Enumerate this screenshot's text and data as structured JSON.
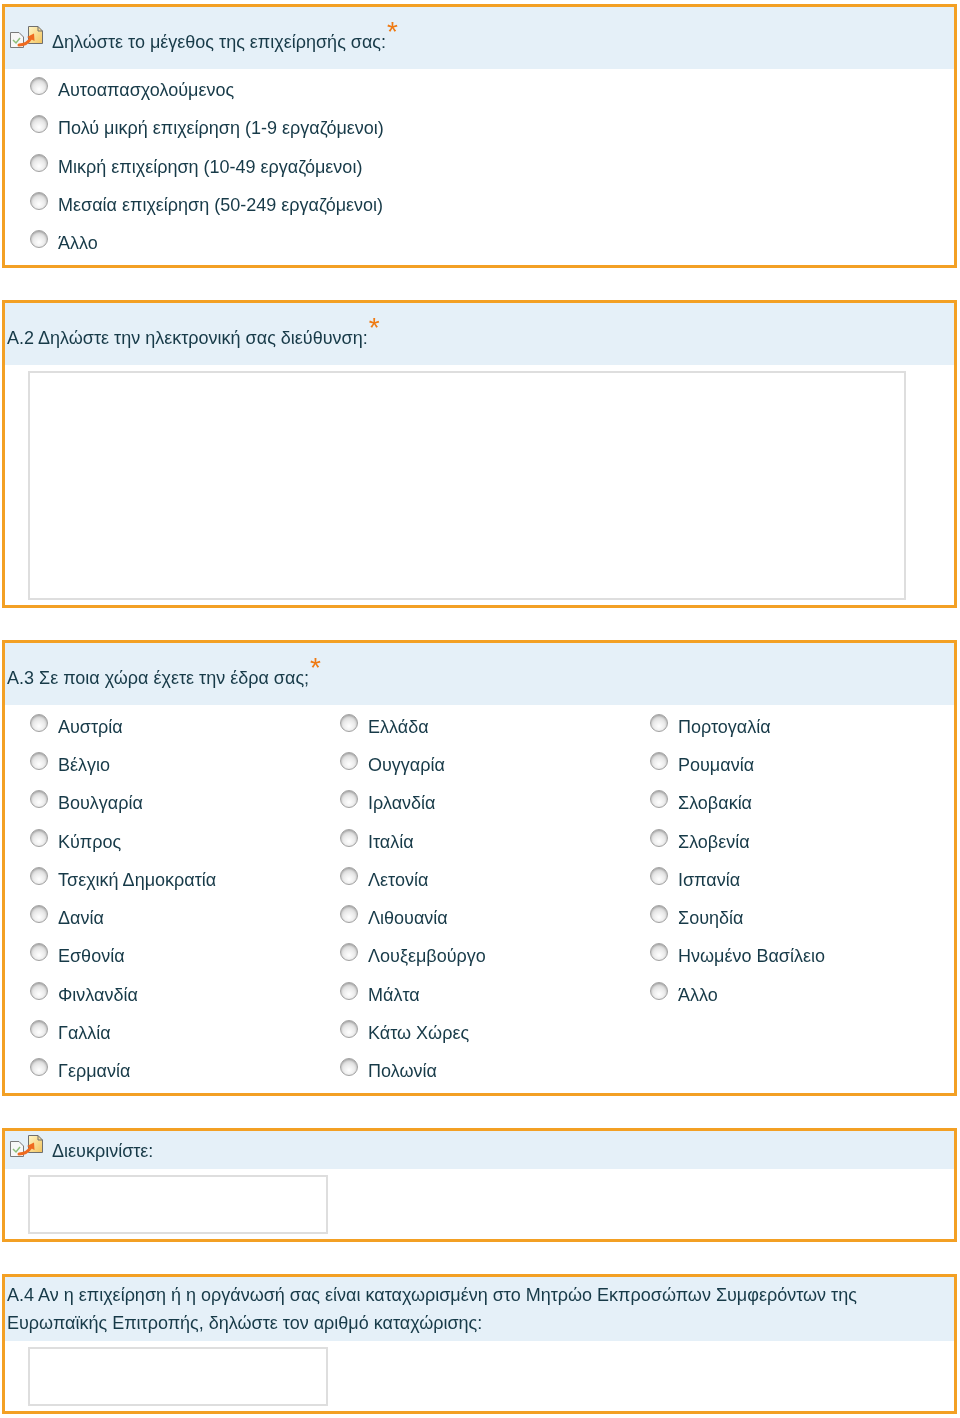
{
  "questions": [
    {
      "kind": "radio",
      "icon": true,
      "title": "Δηλώστε το μέγεθος της επιχείρησής σας:",
      "required_mark": "*",
      "option_columns": [
        [
          {
            "label": "Αυτοαπασχολούμενος",
            "selected": false
          },
          {
            "label": "Πολύ μικρή επιχείρηση (1-9 εργαζόμενοι)",
            "selected": false
          },
          {
            "label": "Μικρή επιχείρηση (10-49 εργαζόμενοι)",
            "selected": false
          },
          {
            "label": "Μεσαία επιχείρηση (50-249 εργαζόμενοι)",
            "selected": false
          },
          {
            "label": "Άλλο",
            "selected": false
          }
        ]
      ]
    },
    {
      "kind": "textarea",
      "icon": false,
      "title": "Α.2 Δηλώστε την ηλεκτρονική σας διεύθυνση:",
      "required_mark": "*"
    },
    {
      "kind": "radio",
      "icon": false,
      "title": "Α.3 Σε ποια χώρα έχετε την έδρα σας;",
      "required_mark": "*",
      "option_columns": [
        [
          {
            "label": "Αυστρία",
            "selected": false
          },
          {
            "label": "Βέλγιο",
            "selected": false
          },
          {
            "label": "Βουλγαρία",
            "selected": false
          },
          {
            "label": "Κύπρος",
            "selected": false
          },
          {
            "label": "Τσεχική Δημοκρατία",
            "selected": false
          },
          {
            "label": "Δανία",
            "selected": false
          },
          {
            "label": "Εσθονία",
            "selected": false
          },
          {
            "label": "Φινλανδία",
            "selected": false
          },
          {
            "label": "Γαλλία",
            "selected": false
          },
          {
            "label": "Γερμανία",
            "selected": false
          }
        ],
        [
          {
            "label": "Ελλάδα",
            "selected": false
          },
          {
            "label": "Ουγγαρία",
            "selected": false
          },
          {
            "label": "Ιρλανδία",
            "selected": false
          },
          {
            "label": "Ιταλία",
            "selected": false
          },
          {
            "label": "Λετονία",
            "selected": false
          },
          {
            "label": "Λιθουανία",
            "selected": false
          },
          {
            "label": "Λουξεμβούργο",
            "selected": false
          },
          {
            "label": "Μάλτα",
            "selected": false
          },
          {
            "label": "Κάτω Χώρες",
            "selected": false
          },
          {
            "label": "Πολωνία",
            "selected": false
          }
        ],
        [
          {
            "label": "Πορτογαλία",
            "selected": false
          },
          {
            "label": "Ρουμανία",
            "selected": false
          },
          {
            "label": "Σλοβακία",
            "selected": false
          },
          {
            "label": "Σλοβενία",
            "selected": false
          },
          {
            "label": "Ισπανία",
            "selected": false
          },
          {
            "label": "Σουηδία",
            "selected": false
          },
          {
            "label": "Ηνωμένο Βασίλειο",
            "selected": false
          },
          {
            "label": "Άλλο",
            "selected": false
          }
        ]
      ]
    },
    {
      "kind": "text",
      "icon": true,
      "title": "Διευκρινίστε:"
    },
    {
      "kind": "text",
      "icon": false,
      "title": "Α.4 Αν η επιχείρηση ή η οργάνωσή σας είναι καταχωρισμένη στο Μητρώο Εκπροσώπων Συμφερόντων της Ευρωπαϊκής Επιτροπής, δηλώστε τον αριθμό καταχώρισης:"
    }
  ]
}
